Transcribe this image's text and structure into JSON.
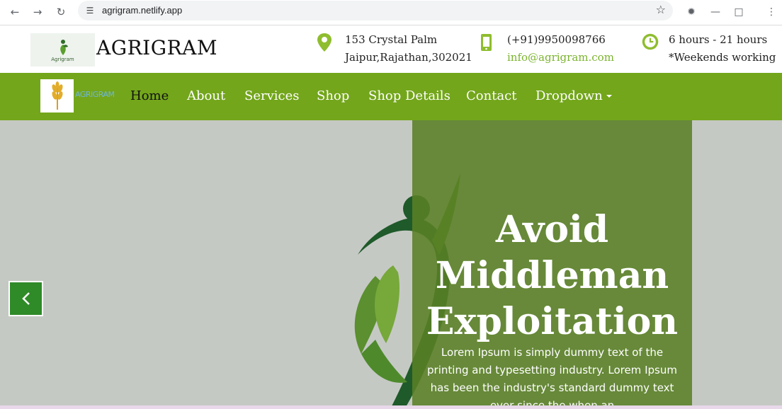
{
  "browser": {
    "url": "agrigram.netlify.app",
    "icons": [
      "back-icon",
      "forward-icon",
      "reload-icon",
      "site-info-icon",
      "star-icon",
      "extension-icon",
      "minimize-icon",
      "puzzle-icon",
      "menu-icon"
    ]
  },
  "header": {
    "logo_small_text": "Agrigram",
    "brand": "AGRIGRAM",
    "address_line1": "153 Crystal Palm",
    "address_line2": "Jaipur,Rajathan,302021",
    "phone": "(+91)9950098766",
    "email": "info@agrigram.com",
    "hours_line1": "6 hours - 21 hours",
    "hours_line2": "*Weekends working",
    "icons": [
      "location-pin-icon",
      "phone-icon",
      "clock-icon"
    ]
  },
  "nav": {
    "logo_text": "AGRIGRAM",
    "items": [
      "Home",
      "About",
      "Services",
      "Shop",
      "Shop Details",
      "Contact",
      "Dropdown"
    ],
    "active": "Home"
  },
  "hero": {
    "title_line1": "Avoid",
    "title_line2": "Middleman",
    "title_line3": "Exploitation",
    "body": "Lorem Ipsum is simply dummy text of the printing and typesetting industry. Lorem Ipsum has been the industry's standard dummy text ever since the when an"
  },
  "colors": {
    "nav_green": "#73a61b",
    "accent_green": "#7bb32e",
    "overlay_green": "#5a8026",
    "hero_bg": "#c5c9c4",
    "prev_button": "#2f8a28"
  }
}
